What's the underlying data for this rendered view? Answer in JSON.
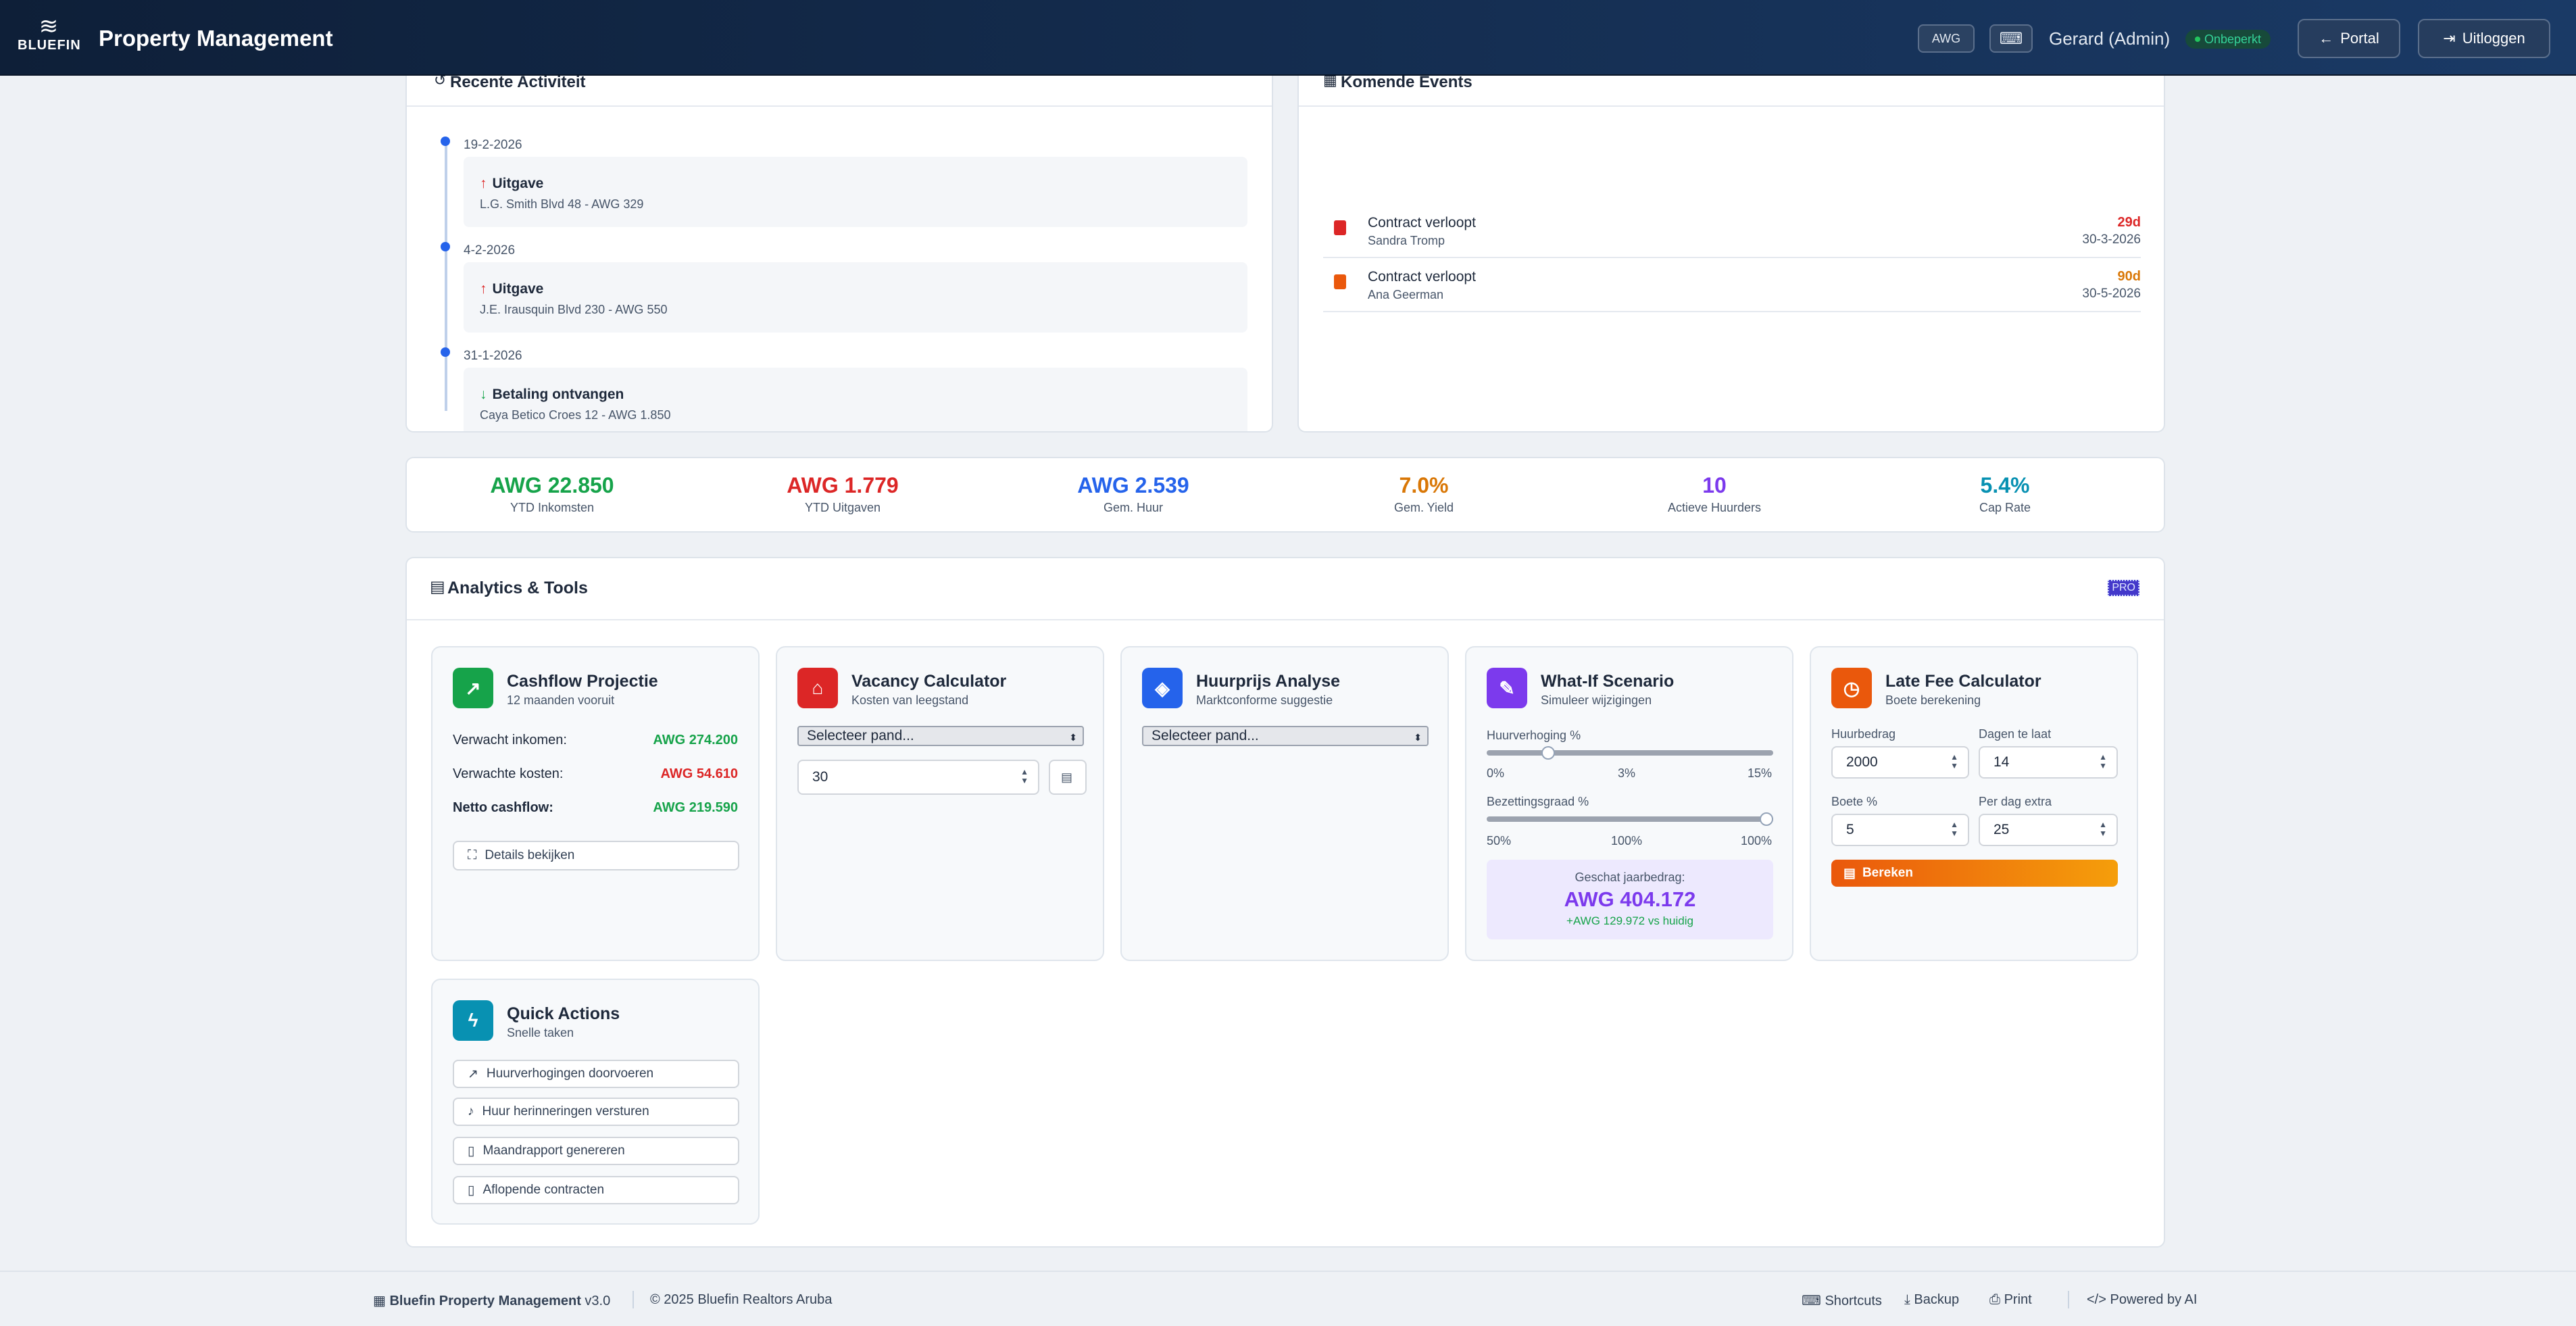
{
  "header": {
    "brand_waves": "≋",
    "brand_word": "BLUEFIN",
    "title": "Property Management",
    "currency_chip": "AWG",
    "keyboard_icon": "⌨",
    "user": "Gerard (Admin)",
    "status": "Onbeperkt",
    "portal_icon": "←",
    "portal_label": "Portal",
    "logout_icon": "⇥",
    "logout_label": "Uitloggen"
  },
  "activity": {
    "title": "Recente Activiteit",
    "items": [
      {
        "date": "19-2-2026",
        "arrow": "↑",
        "title": "Uitgave",
        "sub": "L.G. Smith Blvd 48 - AWG 329"
      },
      {
        "date": "4-2-2026",
        "arrow": "↑",
        "title": "Uitgave",
        "sub": "J.E. Irausquin Blvd 230 - AWG 550"
      },
      {
        "date": "31-1-2026",
        "arrow": "↓",
        "title": "Betaling ontvangen",
        "sub": "Caya Betico Croes 12 - AWG 1.850"
      }
    ]
  },
  "events": {
    "title": "Komende Events",
    "items": [
      {
        "title": "Contract verloopt",
        "sub": "Sandra Tromp",
        "days": "29d",
        "date": "30-3-2026"
      },
      {
        "title": "Contract verloopt",
        "sub": "Ana Geerman",
        "days": "90d",
        "date": "30-5-2026"
      }
    ]
  },
  "kpis": [
    {
      "value": "AWG 22.850",
      "label": "YTD Inkomsten",
      "color": "#16a34a"
    },
    {
      "value": "AWG 1.779",
      "label": "YTD Uitgaven",
      "color": "#dc2626"
    },
    {
      "value": "AWG 2.539",
      "label": "Gem. Huur",
      "color": "#2563eb"
    },
    {
      "value": "7.0%",
      "label": "Gem. Yield",
      "color": "#d97706"
    },
    {
      "value": "10",
      "label": "Actieve Huurders",
      "color": "#7c3aed"
    },
    {
      "value": "5.4%",
      "label": "Cap Rate",
      "color": "#0891b2"
    }
  ],
  "analytics": {
    "title": "Analytics & Tools",
    "badge": "PRO",
    "cashflow": {
      "title": "Cashflow Projectie",
      "sub": "12 maanden vooruit",
      "rows": [
        {
          "label": "Verwacht inkomen:",
          "value": "AWG 274.200"
        },
        {
          "label": "Verwachte kosten:",
          "value": "AWG 54.610"
        },
        {
          "label": "Netto cashflow:",
          "value": "AWG 219.590"
        }
      ],
      "details": "Details bekijken"
    },
    "vacancy": {
      "title": "Vacancy Calculator",
      "sub": "Kosten van leegstand",
      "select": "Selecteer pand...",
      "days": "30"
    },
    "rent": {
      "title": "Huurprijs Analyse",
      "sub": "Marktconforme suggestie",
      "select": "Selecteer pand..."
    },
    "whatif": {
      "title": "What-If Scenario",
      "sub": "Simuleer wijzigingen",
      "raise_label": "Huurverhoging %",
      "raise_ticks": [
        "0%",
        "3%",
        "15%"
      ],
      "raise_value": 3,
      "occ_label": "Bezettingsgraad %",
      "occ_ticks": [
        "50%",
        "100%",
        "100%"
      ],
      "occ_value": 100,
      "result_label": "Geschat jaarbedrag:",
      "result_value": "AWG 404.172",
      "result_delta": "+AWG 129.972 vs huidig"
    },
    "latefee": {
      "title": "Late Fee Calculator",
      "sub": "Boete berekening",
      "rent_label": "Huurbedrag",
      "rent_value": "2000",
      "days_label": "Dagen te laat",
      "days_value": "14",
      "pct_label": "Boete %",
      "pct_value": "5",
      "extra_label": "Per dag extra",
      "extra_value": "25",
      "button": "Bereken"
    },
    "quick": {
      "title": "Quick Actions",
      "sub": "Snelle taken",
      "actions": [
        "Huurverhogingen doorvoeren",
        "Huur herinneringen versturen",
        "Maandrapport genereren",
        "Aflopende contracten"
      ]
    }
  },
  "footer": {
    "app": "Bluefin Property Management",
    "version": "v3.0",
    "copyright": "© 2025 Bluefin Realtors Aruba",
    "shortcuts": "Shortcuts",
    "backup": "Backup",
    "print": "Print",
    "powered": "Powered by AI"
  }
}
